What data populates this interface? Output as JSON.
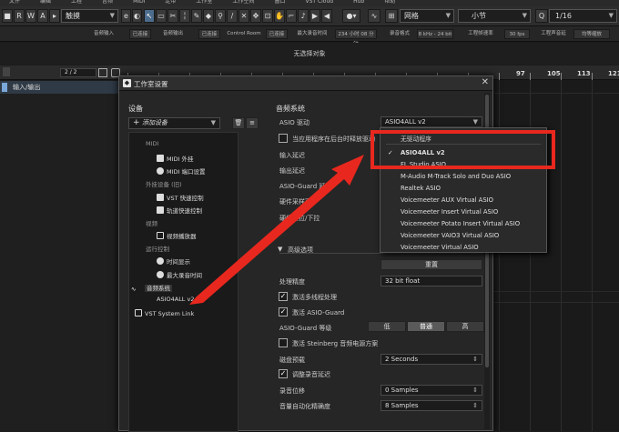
{
  "menubar": {
    "items": [
      "文件",
      "编辑",
      "工程",
      "音频",
      "MIDI",
      "走带",
      "工作室",
      "工作空间",
      "窗口",
      "VST Cloud",
      "Hub",
      "帮助"
    ]
  },
  "toolbar": {
    "tool_buttons": [
      "R",
      "W",
      "A"
    ],
    "mode_select": "触摸",
    "snap_select": "网格",
    "quantize_select": "小节",
    "quant_value": "1/16",
    "icons": [
      "stop-icon",
      "return-icon",
      "pointer-icon",
      "range-icon",
      "split-icon",
      "glue-icon",
      "erase-icon",
      "zoom-icon",
      "mute-icon",
      "drumstick-icon",
      "hand-icon",
      "line-icon",
      "scrub-icon",
      "color-icon",
      "snap-icon",
      "quantize-icon"
    ]
  },
  "infobar": {
    "items": [
      {
        "text": "音频输入"
      },
      {
        "text": "已连接"
      },
      {
        "text": "音频输出"
      },
      {
        "text": "已连接"
      },
      {
        "text": "Control Room"
      },
      {
        "text": "已连接"
      },
      {
        "text": "最大录音时间"
      },
      {
        "text": "234 小时 08 分钟"
      },
      {
        "text": "录音格式"
      },
      {
        "text": "8 kHz - 24 bit"
      },
      {
        "text": "工程帧速率"
      },
      {
        "text": "30 fps"
      },
      {
        "text": "工程声音延"
      },
      {
        "text": "均等缩放"
      }
    ]
  },
  "selection_bar": {
    "text": "无选择对象"
  },
  "track_header": {
    "counter": "2 / 2"
  },
  "track": {
    "name": "输入/输出"
  },
  "ruler": {
    "labels": [
      "97",
      "105",
      "113",
      "121"
    ]
  },
  "dialog": {
    "title": "工作室设置",
    "devices_label": "设备",
    "add_device": "添加设备",
    "tree": [
      {
        "kind": "cat",
        "label": "MIDI"
      },
      {
        "kind": "item",
        "label": "MIDI 外挂",
        "icon": "midi-ext-icon"
      },
      {
        "kind": "item",
        "label": "MIDI 端口设置",
        "icon": "midi-port-icon"
      },
      {
        "kind": "cat",
        "label": "外挂设备 (旧)"
      },
      {
        "kind": "item",
        "label": "VST 快速控制",
        "icon": "vst-qc-icon"
      },
      {
        "kind": "item",
        "label": "轨道快速控制",
        "icon": "track-qc-icon"
      },
      {
        "kind": "cat",
        "label": "视频"
      },
      {
        "kind": "item",
        "label": "视频播放器",
        "icon": "video-icon"
      },
      {
        "kind": "cat",
        "label": "运行控制"
      },
      {
        "kind": "item",
        "label": "时间显示",
        "icon": "clock-icon"
      },
      {
        "kind": "item",
        "label": "最大录音时间",
        "icon": "clock-icon"
      },
      {
        "kind": "sel",
        "label": "音频系统",
        "icon": "waveform-icon"
      },
      {
        "kind": "sub",
        "label": "ASIO4ALL v2"
      },
      {
        "kind": "item2",
        "label": "VST System Link",
        "icon": "monitor-icon"
      }
    ],
    "audio_system": {
      "section_title": "音频系统",
      "asio_driver_label": "ASIO 驱动",
      "asio_driver_value": "ASIO4ALL v2",
      "release_driver_label": "当应用程序在后台时释放驱动",
      "input_latency_label": "输入延迟",
      "output_latency_label": "输出延迟",
      "asio_guard_latency_label": "ASIO-Guard 延迟",
      "hw_sample_rate_label": "硬件采样率",
      "pulldown_label": "硬件上拉/下拉",
      "advanced_label": "高级选项",
      "reset_label": "重置",
      "precision_label": "处理精度",
      "precision_value": "32 bit float",
      "multithread_label": "激活多线程处理",
      "asio_guard_label": "激活 ASIO-Guard",
      "asio_guard_level_label": "ASIO-Guard 等级",
      "levels": [
        "低",
        "普通",
        "高"
      ],
      "steinberg_power_label": "激活 Steinberg 音频电源方案",
      "disk_preload_label": "磁盘预载",
      "disk_preload_value": "2 Seconds",
      "adjust_rec_label": "调整录音延迟",
      "rec_offset_label": "录音位移",
      "rec_offset_value": "0 Samples",
      "auto_precision_label": "音量自动化精确度",
      "auto_precision_value": "8 Samples"
    }
  },
  "dropdown": {
    "items": [
      "无驱动程序",
      "ASIO4ALL v2",
      "FL Studio ASIO",
      "M-Audio M-Track Solo and Duo ASIO",
      "Realtek ASIO",
      "Voicemeeter AUX Virtual ASIO",
      "Voicemeeter Insert Virtual ASIO",
      "Voicemeeter Potato Insert Virtual ASIO",
      "Voicemeeter VAIO3 Virtual ASIO",
      "Voicemeeter Virtual ASIO"
    ],
    "selected": "ASIO4ALL v2",
    "check": "✓"
  },
  "colors": {
    "highlight": "#e8281e",
    "arrow": "#e8281e"
  }
}
